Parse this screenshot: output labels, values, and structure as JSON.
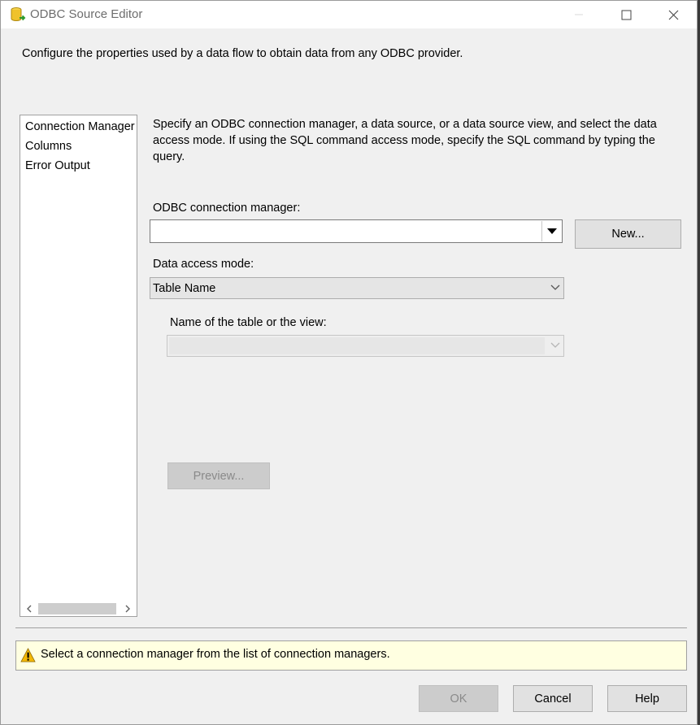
{
  "window": {
    "title": "ODBC Source Editor",
    "controls": [
      "minimize",
      "maximize",
      "close"
    ]
  },
  "header": {
    "description": "Configure the properties used by a data flow to obtain data from any ODBC provider."
  },
  "nav": {
    "items": [
      {
        "label": "Connection Manager",
        "selected": true
      },
      {
        "label": "Columns",
        "selected": false
      },
      {
        "label": "Error Output",
        "selected": false
      }
    ],
    "scroll_left": "<",
    "scroll_right": ">"
  },
  "main": {
    "description": "Specify an ODBC connection manager, a data source, or a data source view, and select the data access mode. If using the SQL command access mode, specify the SQL command by typing the query.",
    "connection_manager_label": "ODBC connection manager:",
    "connection_manager_value": "",
    "new_button": "New...",
    "access_mode_label": "Data access mode:",
    "access_mode_value": "Table Name",
    "table_label": "Name of the table or the view:",
    "table_value": "",
    "preview_button": "Preview..."
  },
  "status": {
    "icon": "warning-icon",
    "message": "Select a connection manager from the list of connection managers."
  },
  "footer": {
    "ok": "OK",
    "cancel": "Cancel",
    "help": "Help"
  },
  "colors": {
    "dialog_bg": "#f0f0f0",
    "status_bg": "#ffffe1",
    "warning": "#f2b705"
  }
}
